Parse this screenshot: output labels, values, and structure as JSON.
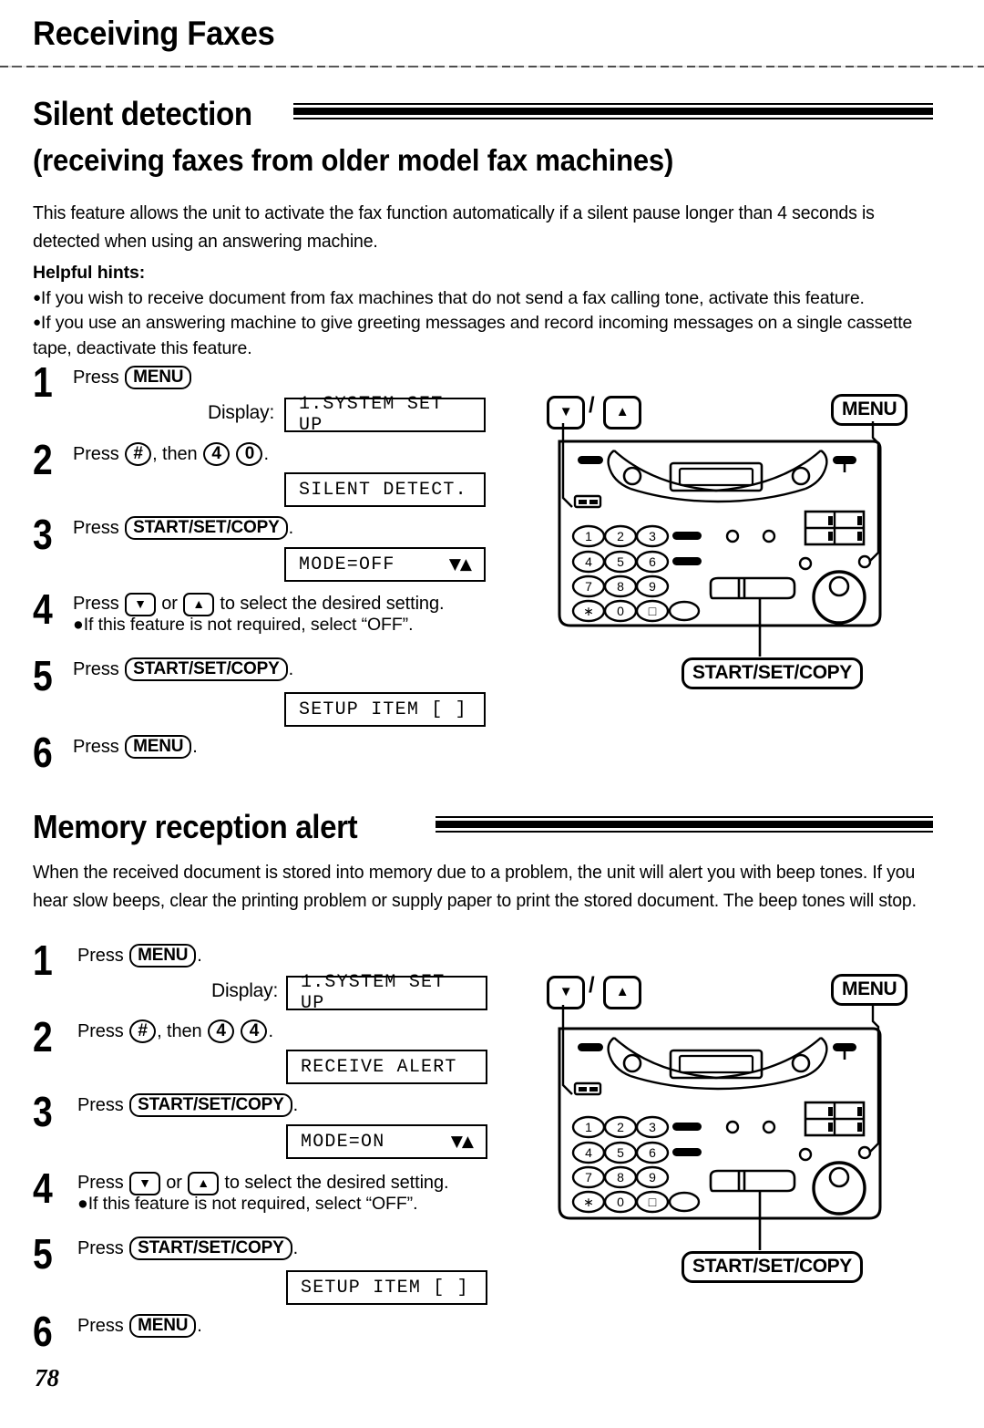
{
  "chapter": {
    "title": "Receiving Faxes"
  },
  "page_number": "78",
  "sections": [
    {
      "id": "silent-detection",
      "title": "Silent detection",
      "subtitle": "(receiving faxes from older model fax machines)",
      "intro": "This feature allows the unit to activate the fax function automatically if a silent pause longer than 4 seconds is detected when using an answering machine.",
      "hints_label": "Helpful hints:",
      "hints": [
        "If you wish to receive document from fax machines that do not send a fax calling tone, activate this feature.",
        "If you use an answering machine to give greeting messages and record incoming messages on a single  cassette tape, deactivate this feature."
      ],
      "display_label": "Display:",
      "steps": [
        {
          "num": "1",
          "prefix": "Press",
          "keys": [
            "MENU"
          ],
          "suffix": ""
        },
        {
          "num": "2",
          "prefix": "Press",
          "keys": [
            "#",
            "4",
            "0"
          ],
          "suffix": "."
        },
        {
          "num": "3",
          "prefix": "Press",
          "keys": [
            "START/SET/COPY"
          ],
          "suffix": "."
        },
        {
          "num": "4",
          "prefix": "Press",
          "keys": [
            "▼",
            "▲"
          ],
          "suffix": "to select the desired setting.",
          "note": "If this feature is not required, select “OFF”."
        },
        {
          "num": "5",
          "prefix": "Press",
          "keys": [
            "START/SET/COPY"
          ],
          "suffix": "."
        },
        {
          "num": "6",
          "prefix": "Press",
          "keys": [
            "MENU"
          ],
          "suffix": "."
        }
      ],
      "lcds": [
        {
          "text": "1.SYSTEM SET UP",
          "arrows": ""
        },
        {
          "text": "SILENT DETECT.",
          "arrows": ""
        },
        {
          "text": "MODE=OFF",
          "arrows": "▼▲"
        },
        {
          "text": "SETUP ITEM [  ]",
          "arrows": ""
        }
      ],
      "diagram": {
        "callout_updown": {
          "down": "▼",
          "separator": "/",
          "up": "▲"
        },
        "callout_menu": "MENU",
        "callout_start": "START/SET/COPY",
        "keypad": [
          "1",
          "2",
          "3",
          "4",
          "5",
          "6",
          "7",
          "8",
          "9",
          "∗",
          "0",
          "□"
        ]
      }
    },
    {
      "id": "memory-reception-alert",
      "title": "Memory reception alert",
      "subtitle": "",
      "intro": "When the received document is stored into memory due to a problem, the unit will alert you with beep tones. If you hear slow beeps, clear the printing problem or supply paper to print the stored document. The beep tones will stop.",
      "display_label": "Display:",
      "steps": [
        {
          "num": "1",
          "prefix": "Press",
          "keys": [
            "MENU"
          ],
          "suffix": "."
        },
        {
          "num": "2",
          "prefix": "Press",
          "keys": [
            "#",
            "4",
            "4"
          ],
          "suffix": "."
        },
        {
          "num": "3",
          "prefix": "Press",
          "keys": [
            "START/SET/COPY"
          ],
          "suffix": "."
        },
        {
          "num": "4",
          "prefix": "Press",
          "keys": [
            "▼",
            "▲"
          ],
          "suffix": "to select the desired setting.",
          "note": "If this feature is not required, select “OFF”."
        },
        {
          "num": "5",
          "prefix": "Press",
          "keys": [
            "START/SET/COPY"
          ],
          "suffix": "."
        },
        {
          "num": "6",
          "prefix": "Press",
          "keys": [
            "MENU"
          ],
          "suffix": "."
        }
      ],
      "lcds": [
        {
          "text": "1.SYSTEM SET UP",
          "arrows": ""
        },
        {
          "text": "RECEIVE ALERT",
          "arrows": ""
        },
        {
          "text": "MODE=ON",
          "arrows": "▼▲"
        },
        {
          "text": "SETUP ITEM [  ]",
          "arrows": ""
        }
      ],
      "diagram": {
        "callout_updown": {
          "down": "▼",
          "separator": "/",
          "up": "▲"
        },
        "callout_menu": "MENU",
        "callout_start": "START/SET/COPY",
        "keypad": [
          "1",
          "2",
          "3",
          "4",
          "5",
          "6",
          "7",
          "8",
          "9",
          "∗",
          "0",
          "□"
        ]
      }
    }
  ]
}
